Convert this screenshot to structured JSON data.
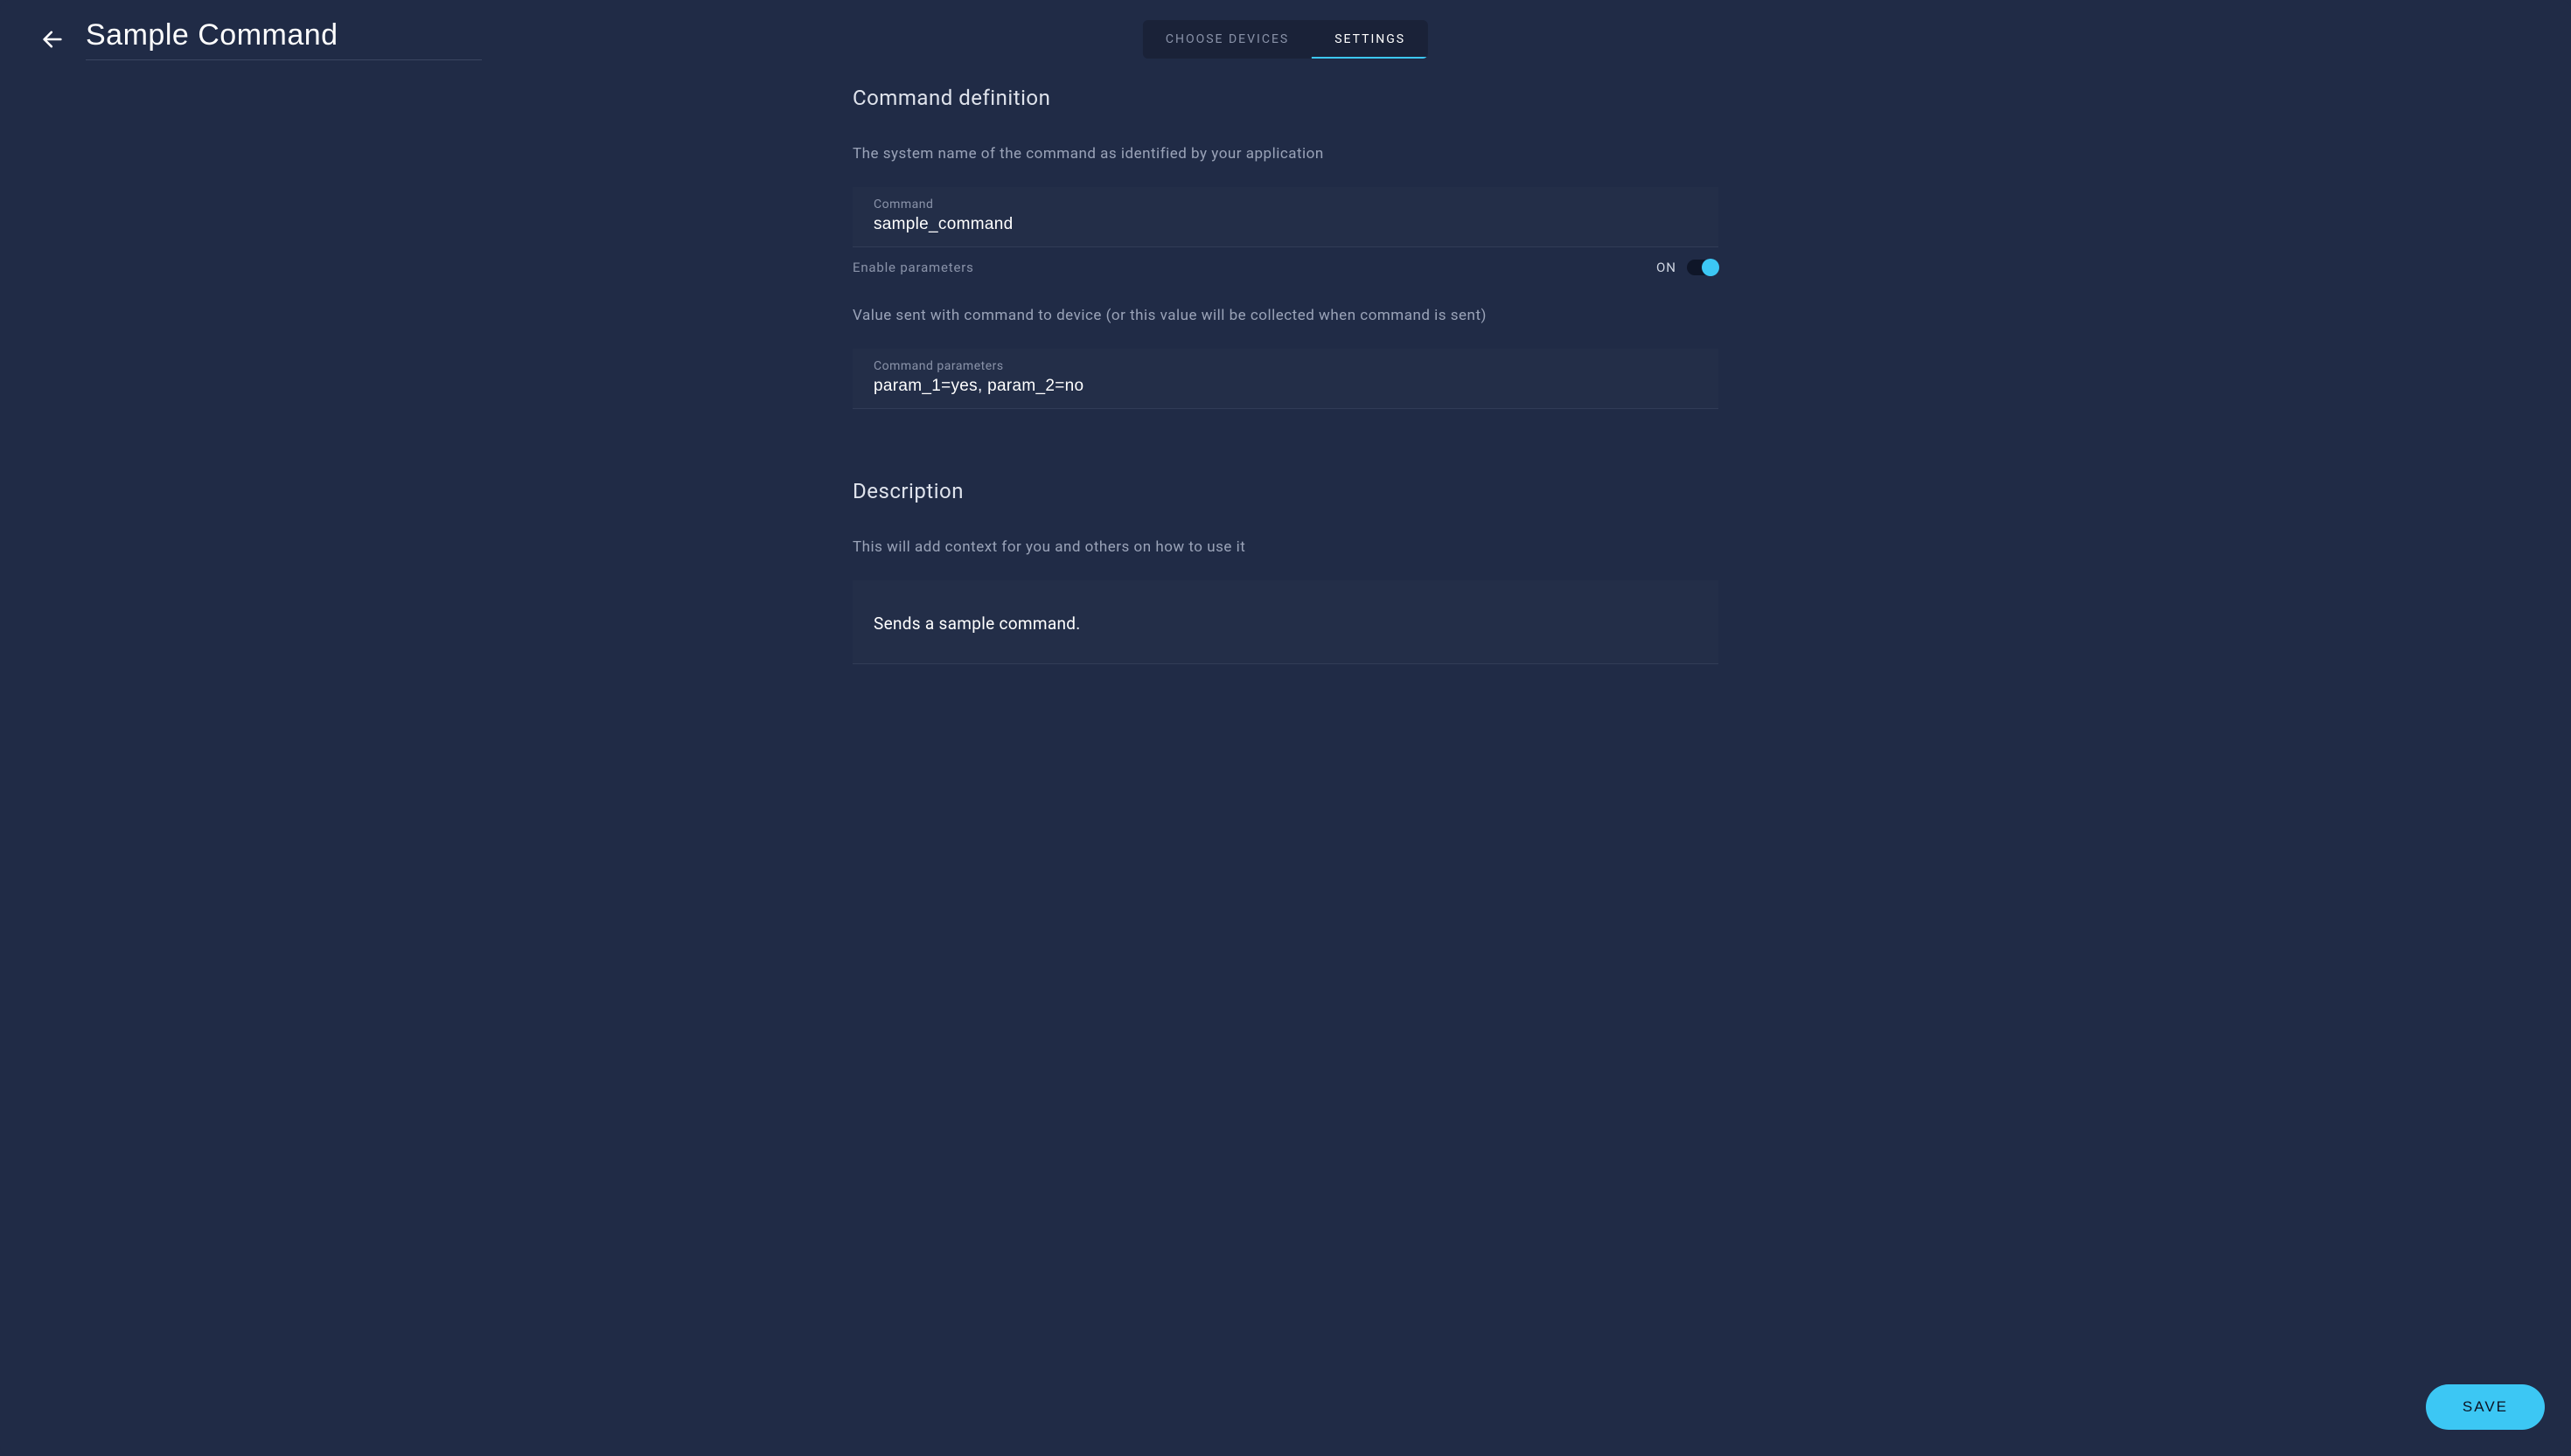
{
  "header": {
    "title": "Sample Command",
    "tabs": {
      "choose_devices": "CHOOSE DEVICES",
      "settings": "SETTINGS"
    }
  },
  "sections": {
    "definition": {
      "heading": "Command definition",
      "help": "The system name of the command as identified by your application",
      "command_field": {
        "label": "Command",
        "value": "sample_command"
      },
      "enable_params": {
        "label": "Enable parameters",
        "state": "ON"
      },
      "params_help": "Value sent with command to device (or this value will be collected when command is sent)",
      "params_field": {
        "label": "Command parameters",
        "value": "param_1=yes, param_2=no"
      }
    },
    "description": {
      "heading": "Description",
      "help": "This will add context for you and others on how to use it",
      "value": "Sends a sample command."
    }
  },
  "footer": {
    "save": "SAVE"
  }
}
